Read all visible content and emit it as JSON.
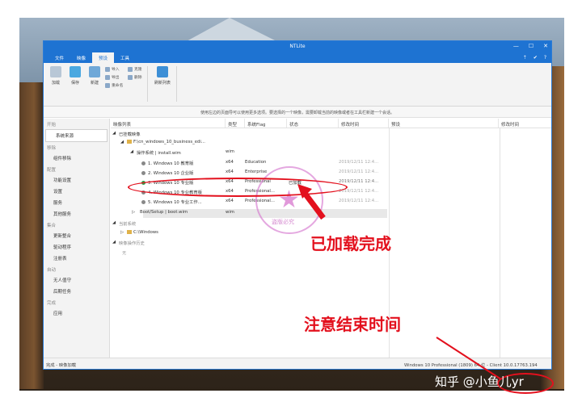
{
  "window": {
    "title": "NTLite",
    "controls": [
      "—",
      "☐",
      "✕"
    ]
  },
  "menu": {
    "tabs": [
      "文件",
      "映像",
      "预设",
      "工具"
    ],
    "active": "预设",
    "right_icons": [
      "arrow-up-icon",
      "twitter-icon",
      "help-icon"
    ],
    "right_glyphs": [
      "⇡",
      "✔",
      "?"
    ]
  },
  "ribbon": {
    "load": "加载",
    "save": "保存",
    "new": "新建",
    "import": "导入",
    "export": "导出",
    "delete": "删除",
    "copy": "克隆",
    "rename": "重命名",
    "refresh": "刷新列表"
  },
  "infobar": "使用左边的页面导可以使用更多选项。要选择的一个映像，需要卸载当前的映像或者在工具栏新建一个会话。",
  "sidebar": {
    "groups": [
      {
        "heading": "开始",
        "items": [
          "系统来源"
        ]
      },
      {
        "heading": "移除",
        "items": [
          "组件移除"
        ]
      },
      {
        "heading": "配置",
        "items": [
          "功能设置",
          "设置",
          "服务",
          "其他服务"
        ]
      },
      {
        "heading": "集合",
        "items": [
          "更新整合",
          "驱动程序",
          "注册表"
        ]
      },
      {
        "heading": "自动",
        "items": [
          "无人值守",
          "后期任务"
        ]
      },
      {
        "heading": "完成",
        "items": [
          "应用"
        ]
      }
    ]
  },
  "columns": {
    "tree": [
      "映像列表",
      "类型",
      "系统Flag",
      "状态",
      "修改时间"
    ],
    "right": [
      "预设",
      "修改时间"
    ]
  },
  "tree": {
    "imported": "已挂载映像",
    "iso_path": "F:\\cn_windows_10_business_edi...",
    "os_group": "操作系统  |  install.wim",
    "os_type": "wim",
    "images": [
      {
        "name": "1. Windows 10 教育版",
        "arch": "x64",
        "flag": "Education",
        "state": "",
        "time": "2019/12/11 12:4..."
      },
      {
        "name": "2. Windows 10 企业版",
        "arch": "x64",
        "flag": "Enterprise",
        "state": "",
        "time": "2019/12/11 12:4..."
      },
      {
        "name": "3. Windows 10 专业版",
        "arch": "x64",
        "flag": "Professional",
        "state": "已加载",
        "time": "2019/12/11 12:4..."
      },
      {
        "name": "4. Windows 10 专业教育版",
        "arch": "x64",
        "flag": "Professional...",
        "state": "",
        "time": "2019/12/11 12:4..."
      },
      {
        "name": "5. Windows 10 专业工作...",
        "arch": "x64",
        "flag": "Professional...",
        "state": "",
        "time": "2019/12/11 12:4..."
      }
    ],
    "boot": "Boot/Setup  |  boot.wim",
    "boot_type": "wim",
    "current_system": "当前系统",
    "c_windows": "C:\\Windows",
    "history": "映像操作历史",
    "history_none": "无"
  },
  "status": {
    "left": "完成 - 映像加载",
    "right": "Windows 10 Professional (1809) 64 位 - Client 10.0.17763.194"
  },
  "annotations": {
    "loaded": "已加载完成",
    "note_time": "注意结束时间",
    "watermark": "知乎 @小鱼儿yr",
    "stamp_text": "盗版必究"
  },
  "colors": {
    "accent": "#1e73d2",
    "annotation": "#e3101d"
  }
}
